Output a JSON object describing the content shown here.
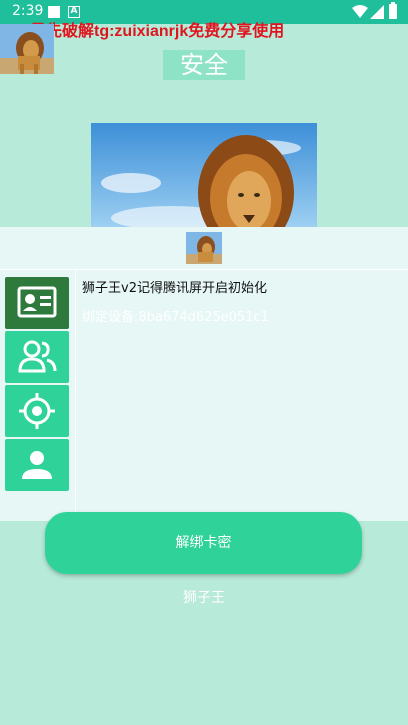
{
  "status_bar": {
    "time": "2:39",
    "icons": [
      "notification-square-icon",
      "a-icon",
      "wifi-icon",
      "signal-icon",
      "battery-icon"
    ],
    "notification_letter": "A"
  },
  "banner": {
    "text": "最先破解tg:zuixianrjk免费分享使用",
    "color": "#e0161f"
  },
  "security_badge": {
    "label": "安全"
  },
  "panel": {
    "title": "狮子王v2记得腾讯屏开启初始化",
    "device": "绑定设备:8ba674d625e051c1",
    "side_items": [
      {
        "icon": "id-card-icon",
        "active": true
      },
      {
        "icon": "users-icon",
        "active": false
      },
      {
        "icon": "crosshair-icon",
        "active": false
      },
      {
        "icon": "person-icon",
        "active": false
      }
    ]
  },
  "actions": {
    "unbind_label": "解绑卡密"
  },
  "footer": {
    "app_name": "狮子王"
  },
  "colors": {
    "background": "#b8ead9",
    "status_bar": "#1fbf9b",
    "accent": "#2fd39a",
    "active_side": "#2e7a3c"
  }
}
